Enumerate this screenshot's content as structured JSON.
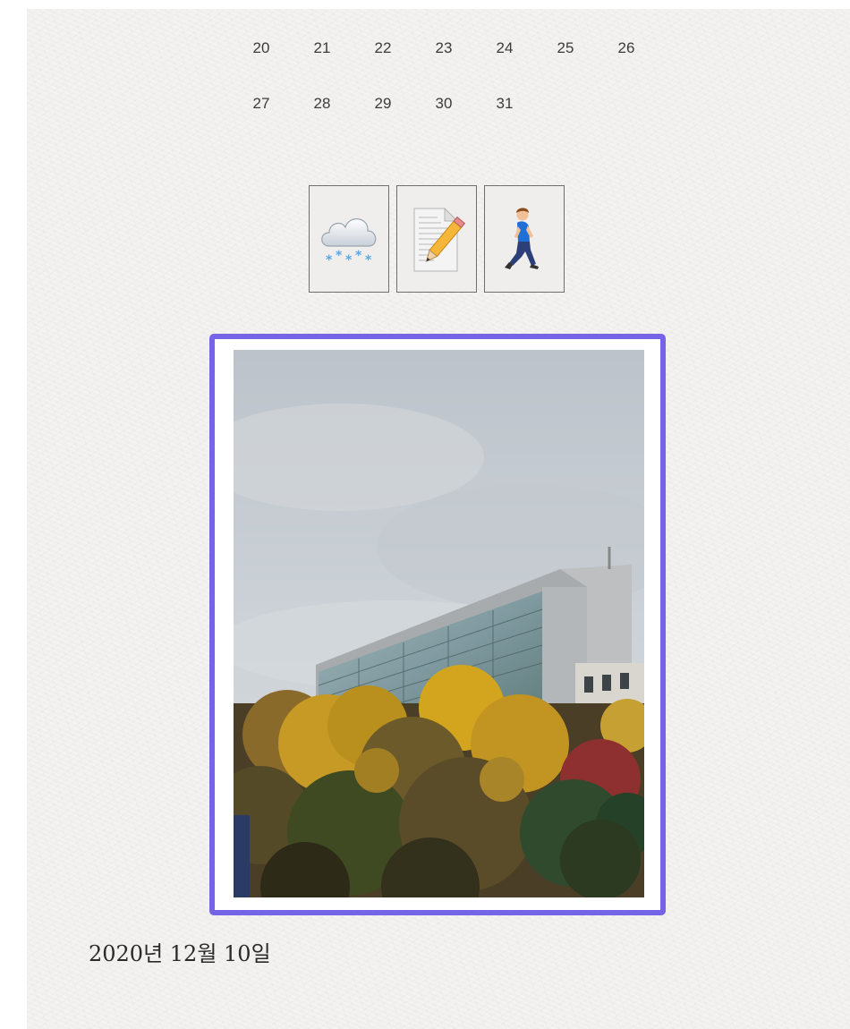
{
  "calendar": {
    "week_rows": [
      [
        "20",
        "21",
        "22",
        "23",
        "24",
        "25",
        "26"
      ],
      [
        "27",
        "28",
        "29",
        "30",
        "31"
      ]
    ]
  },
  "mood_icons": [
    {
      "name": "cloud-snow-icon",
      "meaning": "weather: snow"
    },
    {
      "name": "memo-pencil-icon",
      "meaning": "note/writing"
    },
    {
      "name": "walking-person-icon",
      "meaning": "activity: walking"
    }
  ],
  "photo": {
    "subject": "building-with-autumn-trees",
    "frame_color": "#7565e6"
  },
  "entry": {
    "date": "2020년 12월 10일"
  }
}
